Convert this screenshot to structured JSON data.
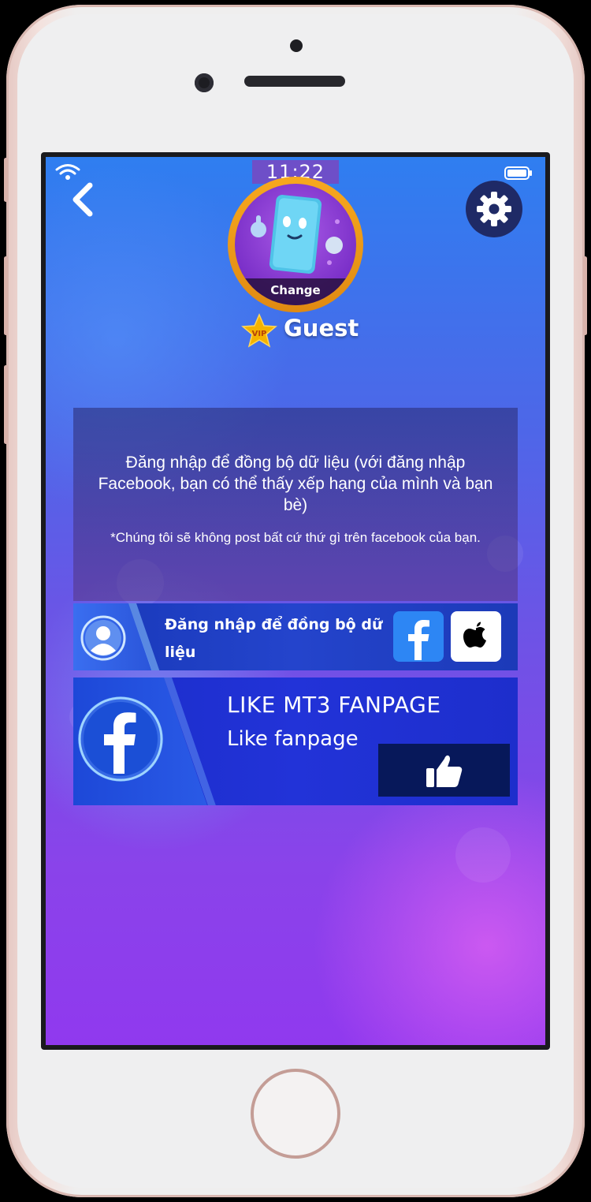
{
  "status_bar": {
    "time": "11:22",
    "wifi_icon": "wifi-icon",
    "battery_icon": "battery-icon"
  },
  "header": {
    "back_icon": "chevron-left-icon",
    "settings_icon": "gear-icon"
  },
  "profile": {
    "avatar_action_label": "Change",
    "vip_badge_label": "VIP",
    "username": "Guest"
  },
  "info": {
    "main_text": "Đăng nhập để đồng bộ dữ liệu (với đăng nhập Facebook, bạn có thể thấy xếp hạng của mình và bạn bè)",
    "note_text": "*Chúng tôi sẽ không post bất cứ thứ gì trên facebook của bạn."
  },
  "login": {
    "label": "Đăng nhập để đồng bộ dữ liệu",
    "facebook_icon": "facebook-icon",
    "apple_icon": "apple-icon"
  },
  "fanpage": {
    "title": "LIKE MT3 FANPAGE",
    "subtitle": "Like fanpage",
    "like_icon": "thumbs-up-icon"
  },
  "colors": {
    "accent_facebook": "#2d86f4",
    "avatar_ring": "#f7a81f",
    "settings_bg": "#1f2a66",
    "like_button_bg": "#07185a"
  }
}
